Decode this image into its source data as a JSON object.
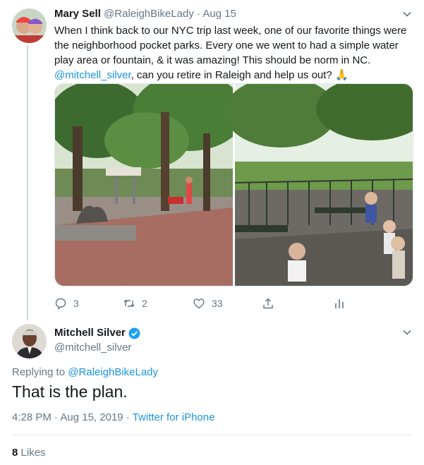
{
  "tweet1": {
    "author_name": "Mary Sell",
    "author_handle": "@RaleighBikeLady",
    "separator": "·",
    "date": "Aug 15",
    "text_main": "When I think back to our NYC trip last week, one of our favorite things were the neighborhood pocket parks. Every one we went to had a simple water play area or fountain, & it was amazing! This should be norm in NC.",
    "mention": "@mitchell_silver",
    "text_after_mention": ", can you retire in Raleigh and help us out? 🙏",
    "actions": {
      "reply_count": "3",
      "retweet_count": "2",
      "like_count": "33"
    },
    "media_icons": [
      "reply-icon",
      "retweet-icon",
      "like-icon",
      "share-icon",
      "analytics-icon"
    ]
  },
  "tweet2": {
    "author_name": "Mitchell Silver",
    "author_handle": "@mitchell_silver",
    "replying_prefix": "Replying to",
    "replying_to": "@RaleighBikeLady",
    "text": "That is the plan.",
    "time": "4:28 PM",
    "separator": "·",
    "date": "Aug 15, 2019",
    "source": "Twitter for iPhone",
    "likes_count": "8",
    "likes_label": "Likes"
  },
  "colors": {
    "link": "#1b95e0",
    "secondary_text": "#657786",
    "primary_text": "#14171a",
    "verified": "#1da1f2"
  }
}
